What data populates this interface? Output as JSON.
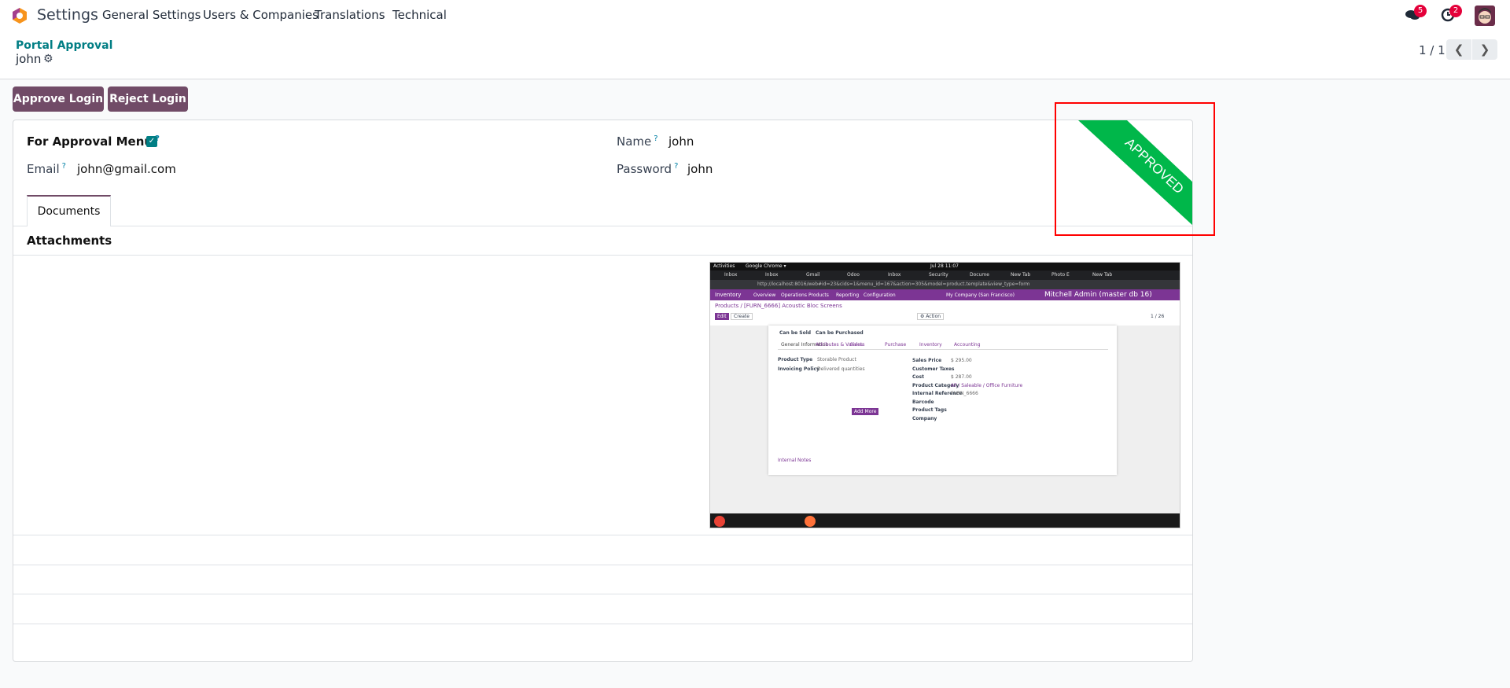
{
  "navbar": {
    "app_name": "Settings",
    "menu": [
      "General Settings",
      "Users & Companies",
      "Translations",
      "Technical"
    ],
    "messages_count": "5",
    "activities_count": "2"
  },
  "breadcrumb": {
    "parent": "Portal Approval",
    "current": "john"
  },
  "pager": {
    "value": "1 / 1"
  },
  "actions": {
    "approve": "Approve Login",
    "reject": "Reject Login"
  },
  "form": {
    "approval_menu_label": "For Approval Menu",
    "approval_menu_checked": true,
    "email_label": "Email",
    "email_value": "john@gmail.com",
    "name_label": "Name",
    "name_value": "john",
    "password_label": "Password",
    "password_value": "john",
    "help": "?"
  },
  "ribbon": {
    "text": "APPROVED",
    "color": "#00b74a"
  },
  "tabs": [
    {
      "label": "Documents",
      "active": true
    }
  ],
  "attachments_label": "Attachments",
  "screenshot": {
    "topbar_left": "Activities",
    "topbar_app": "Google Chrome ▾",
    "clock": "Jul 28  11:07",
    "url": "http://localhost:8016/web#id=23&cids=1&menu_id=167&action=305&model=product.template&view_type=form",
    "app": "Inventory",
    "menu": [
      "Overview",
      "Operations",
      "Products",
      "Reporting",
      "Configuration"
    ],
    "company": "My Company (San Francisco)",
    "user": "Mitchell Admin (master db 16)",
    "breadcrumb": "Products / [FURN_6666] Acoustic Bloc Screens",
    "edit": "Edit",
    "create": "Create",
    "action": "⚙ Action",
    "pager": "1 / 26",
    "checks": [
      "Can be Sold",
      "Can be Purchased"
    ],
    "tabs": [
      "General Information",
      "Attributes & Variants",
      "Sales",
      "Purchase",
      "Inventory",
      "Accounting"
    ],
    "left_fields": [
      [
        "Product Type",
        "Storable Product"
      ],
      [
        "Invoicing Policy",
        "Delivered quantities"
      ]
    ],
    "right_fields": [
      [
        "Sales Price",
        "$ 295.00"
      ],
      [
        "Customer Taxes",
        ""
      ],
      [
        "Cost",
        "$ 287.00"
      ],
      [
        "Product Category",
        "All / Saleable / Office Furniture"
      ],
      [
        "Internal Reference",
        "FURN_6666"
      ],
      [
        "Barcode",
        ""
      ],
      [
        "Product Tags",
        ""
      ],
      [
        "Company",
        ""
      ]
    ],
    "add_more": "Add More",
    "notes": "Internal Notes",
    "tabs_browser": [
      "Inbox",
      "Inbox",
      "Gmail",
      "Odoo",
      "Inbox",
      "Security",
      "Docume",
      "New Tab",
      "Photo E",
      "New Tab"
    ]
  }
}
